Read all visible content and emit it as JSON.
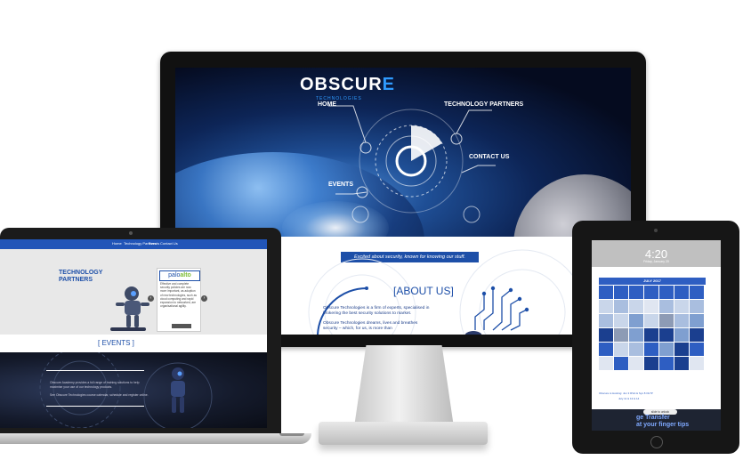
{
  "desktop": {
    "logo_text": "OBSCUR",
    "logo_last": "E",
    "logo_sub": "TECHNOLOGIES",
    "nav": {
      "home": "HOME",
      "technology_partners": "TECHNOLOGY PARTNERS",
      "contact_us": "CONTACT US",
      "events": "EVENTS"
    },
    "tagline": "Excited about security, known for knowing our stuff.",
    "about_title": "[ABOUT US]",
    "about_text_1": "Obscure Technologies is a firm of experts, specialised in brokering the best security solutions to market.",
    "about_text_2": "Obscure Technologies dreams, lives and breathes security – which, for us, is more than"
  },
  "laptop": {
    "nav": [
      "Home",
      "Technology Partners",
      "Events",
      "Contact Us"
    ],
    "title_line1": "TECHNOLOGY",
    "title_line2": "PARTNERS",
    "partner_logo_a": "palo",
    "partner_logo_b": "alto",
    "partner_text": "Effective and complete security policies are now more important, as adoption of new technologies, such as cloud computing and rapid expansion to networked, are organisational agility.",
    "events_title": "[ EVENTS ]",
    "events_text_1": "Obscure Academy provides a full range of training solutions to help maximise your use of our technology products.",
    "events_text_2": "See Obscure Technologies course calendar, schedule and register online."
  },
  "tablet": {
    "time": "4:20",
    "date": "Friday, January 20",
    "month": "JULY 2017",
    "event_text_1": "Obscure is Hosting: Jun 3 RSA & Sys 8 OLTP",
    "event_text_2": "July 11 & 13 & 14",
    "unlock": "slide to unlock",
    "slogan_1": "ge Transfer",
    "slogan_2": "at your finger tips"
  },
  "colors": {
    "brand_blue": "#1d4fa8",
    "accent_blue": "#2f9bff",
    "calendar_blue": "#2e5ec2"
  }
}
